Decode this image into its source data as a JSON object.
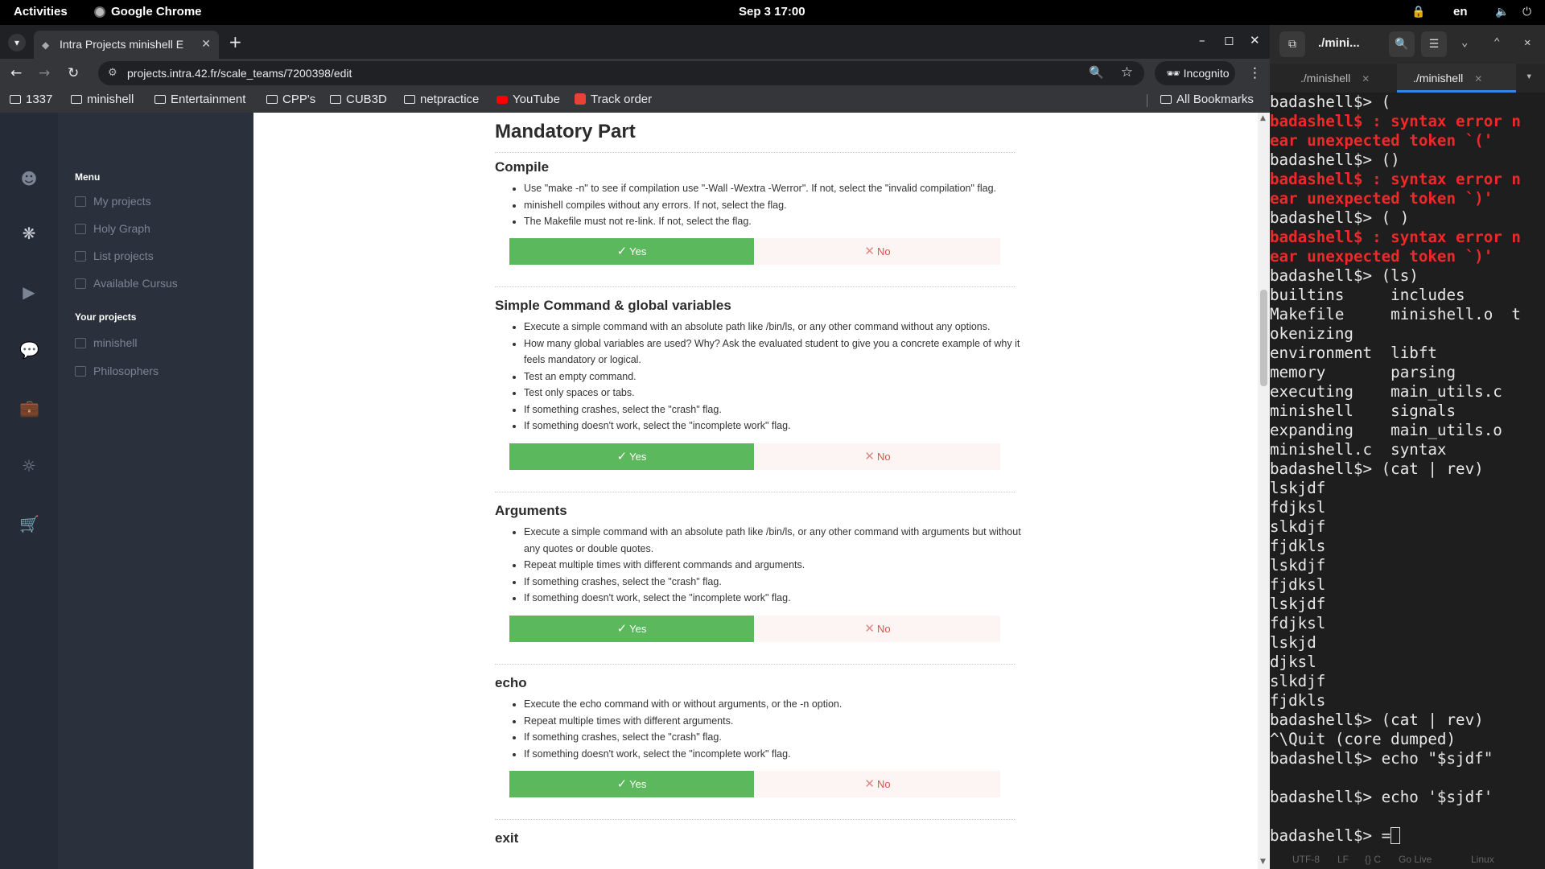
{
  "topbar": {
    "activities": "Activities",
    "app": "Google Chrome",
    "clock": "Sep 3  17:00",
    "lang": "en"
  },
  "chrome": {
    "tab_title": "Intra Projects minishell E",
    "url": "projects.intra.42.fr/scale_teams/7200398/edit",
    "incognito": "Incognito",
    "bookmarks": [
      "1337",
      "minishell",
      "Entertainment",
      "CPP's",
      "CUB3D",
      "netpractice",
      "YouTube",
      "Track order"
    ],
    "all_bookmarks": "All Bookmarks"
  },
  "sidebar": {
    "menu_heading": "Menu",
    "menu_items": [
      "My projects",
      "Holy Graph",
      "List projects",
      "Available Cursus"
    ],
    "projects_heading": "Your projects",
    "project_items": [
      "minishell",
      "Philosophers"
    ]
  },
  "content": {
    "mandatory_title": "Mandatory Part",
    "yes_label": "Yes",
    "no_label": "No",
    "sections": [
      {
        "title": "Compile",
        "bullets": [
          "Use \"make -n\" to see if compilation use \"-Wall -Wextra -Werror\". If not, select the \"invalid compilation\" flag.",
          "minishell compiles without any errors. If not, select the flag.",
          "The Makefile must not re-link. If not, select the flag."
        ]
      },
      {
        "title": "Simple Command & global variables",
        "bullets": [
          "Execute a simple command with an absolute path like /bin/ls, or any other command without any options.",
          "How many global variables are used? Why? Ask the evaluated student to give you a concrete example of why it feels mandatory or logical.",
          "Test an empty command.",
          "Test only spaces or tabs.",
          "If something crashes, select the \"crash\" flag.",
          "If something doesn't work, select the \"incomplete work\" flag."
        ]
      },
      {
        "title": "Arguments",
        "bullets": [
          "Execute a simple command with an absolute path like /bin/ls, or any other command with arguments but without any quotes or double quotes.",
          "Repeat multiple times with different commands and arguments.",
          "If something crashes, select the \"crash\" flag.",
          "If something doesn't work, select the \"incomplete work\" flag."
        ]
      },
      {
        "title": "echo",
        "bullets": [
          "Execute the echo command with or without arguments, or the -n option.",
          "Repeat multiple times with different arguments.",
          "If something crashes, select the \"crash\" flag.",
          "If something doesn't work, select the \"incomplete work\" flag."
        ]
      },
      {
        "title": "exit",
        "bullets": []
      }
    ]
  },
  "terminal": {
    "title": "./mini...",
    "tabs": [
      "./minishell",
      "./minishell"
    ],
    "lines": [
      {
        "t": "badashell$> (",
        "c": ""
      },
      {
        "t": "badashell$ : syntax error n",
        "c": "err"
      },
      {
        "t": "ear unexpected token `('",
        "c": "err"
      },
      {
        "t": "badashell$> ()",
        "c": ""
      },
      {
        "t": "badashell$ : syntax error n",
        "c": "err"
      },
      {
        "t": "ear unexpected token `)'",
        "c": "err"
      },
      {
        "t": "badashell$> ( )",
        "c": ""
      },
      {
        "t": "badashell$ : syntax error n",
        "c": "err"
      },
      {
        "t": "ear unexpected token `)'",
        "c": "err"
      },
      {
        "t": "badashell$> (ls)",
        "c": ""
      },
      {
        "t": "builtins     includes",
        "c": ""
      },
      {
        "t": "Makefile     minishell.o  t",
        "c": ""
      },
      {
        "t": "okenizing",
        "c": ""
      },
      {
        "t": "environment  libft",
        "c": ""
      },
      {
        "t": "memory       parsing",
        "c": ""
      },
      {
        "t": "executing    main_utils.c",
        "c": ""
      },
      {
        "t": "minishell    signals",
        "c": ""
      },
      {
        "t": "expanding    main_utils.o",
        "c": ""
      },
      {
        "t": "minishell.c  syntax",
        "c": ""
      },
      {
        "t": "badashell$> (cat | rev)",
        "c": ""
      },
      {
        "t": "lskjdf",
        "c": ""
      },
      {
        "t": "fdjksl",
        "c": ""
      },
      {
        "t": "slkdjf",
        "c": ""
      },
      {
        "t": "fjdkls",
        "c": ""
      },
      {
        "t": "lskdjf",
        "c": ""
      },
      {
        "t": "fjdksl",
        "c": ""
      },
      {
        "t": "lskjdf",
        "c": ""
      },
      {
        "t": "fdjksl",
        "c": ""
      },
      {
        "t": "lskjd",
        "c": ""
      },
      {
        "t": "djksl",
        "c": ""
      },
      {
        "t": "slkdjf",
        "c": ""
      },
      {
        "t": "fjdkls",
        "c": ""
      },
      {
        "t": "badashell$> (cat | rev)",
        "c": ""
      },
      {
        "t": "^\\Quit (core dumped)",
        "c": ""
      },
      {
        "t": "badashell$> echo \"$sjdf\"",
        "c": ""
      },
      {
        "t": "",
        "c": ""
      },
      {
        "t": "badashell$> echo '$sjdf'",
        "c": ""
      },
      {
        "t": "",
        "c": ""
      }
    ],
    "prompt_last": "badashell$> =",
    "status": [
      "UTF-8",
      "LF",
      "{} C",
      "Go Live",
      "Linux"
    ]
  },
  "colors": {
    "yes_bg": "#5cb85c",
    "no_bg": "#fdf4f4",
    "no_text": "#d9534f",
    "terminal_error": "#ef2929",
    "sidebar_bg": "#2b313c"
  }
}
